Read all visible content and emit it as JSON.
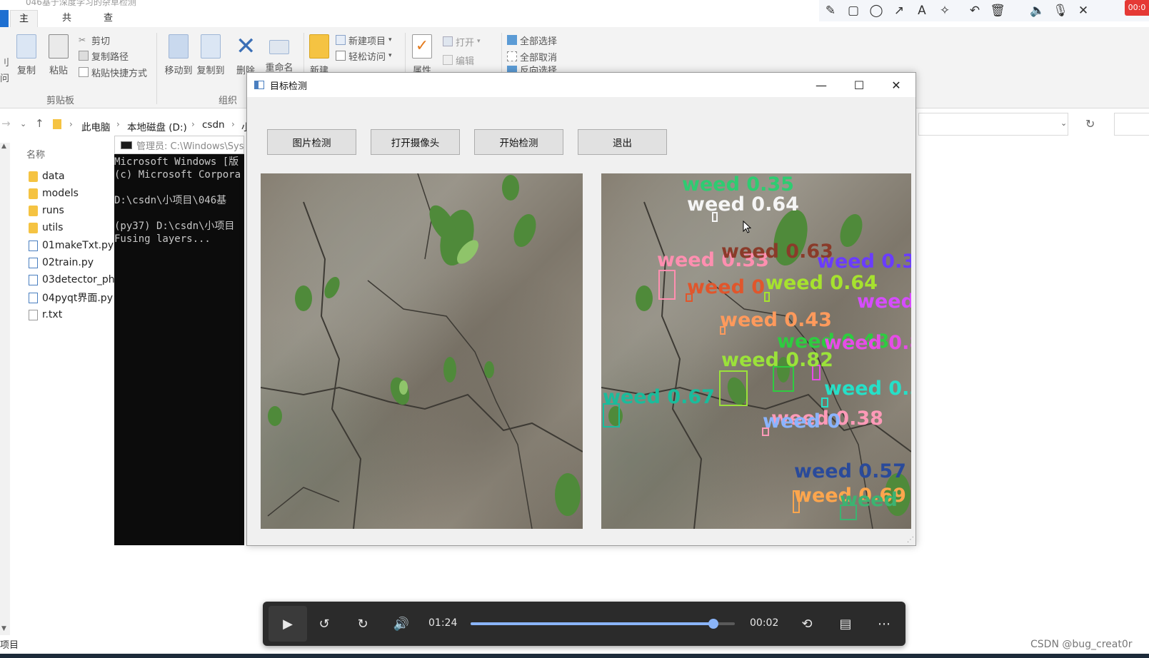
{
  "explorer": {
    "title": "046基于深度学习的杂草检测",
    "tabs": [
      {
        "label": "主页"
      },
      {
        "label": "共享"
      },
      {
        "label": "查看"
      }
    ],
    "ribbon": {
      "copy": "复制",
      "paste": "粘贴",
      "cut": "剪切",
      "copy_path": "复制路径",
      "paste_shortcut": "粘贴快捷方式",
      "move_to": "移动到",
      "copy_to": "复制到",
      "delete": "删除",
      "rename": "重命名",
      "new": "新建",
      "new_item": "新建项目",
      "easy_access": "轻松访问",
      "properties": "属性",
      "open": "打开",
      "edit": "编辑",
      "select_all": "全部选择",
      "select_none": "全部取消",
      "invert_selection": "反向选择",
      "group_clipboard": "剪贴板",
      "group_organize": "组织",
      "partial_left_1": "刂",
      "partial_left_2": "问"
    },
    "breadcrumbs": [
      "此电脑",
      "本地磁盘 (D:)",
      "csdn",
      "小"
    ],
    "column_header": "名称",
    "files": [
      {
        "name": "data",
        "type": "folder"
      },
      {
        "name": "models",
        "type": "folder"
      },
      {
        "name": "runs",
        "type": "folder"
      },
      {
        "name": "utils",
        "type": "folder"
      },
      {
        "name": "01makeTxt.py",
        "type": "py"
      },
      {
        "name": "02train.py",
        "type": "py"
      },
      {
        "name": "03detector_ph",
        "type": "py"
      },
      {
        "name": "04pyqt界面.py",
        "type": "py"
      },
      {
        "name": "r.txt",
        "type": "txt"
      }
    ],
    "status_text": "项目"
  },
  "recorder": {
    "icons": [
      "pencil-icon",
      "rectangle-icon",
      "circle-icon",
      "arrow-icon",
      "text-icon",
      "magic-icon",
      "undo-icon",
      "trash-icon",
      "speaker-icon",
      "mic-icon",
      "close-icon"
    ],
    "time": "00:0"
  },
  "console": {
    "title": "管理员: C:\\Windows\\Sys",
    "lines": [
      "Microsoft Windows [版",
      "(c) Microsoft Corpora",
      "",
      "D:\\csdn\\小项目\\046基",
      "",
      "(py37) D:\\csdn\\小项目",
      "Fusing layers..."
    ]
  },
  "detector": {
    "window_title": "目标检测",
    "buttons": {
      "image_detect": "图片检测",
      "open_camera": "打开摄像头",
      "start_detect": "开始检测",
      "exit": "退出"
    },
    "detections": [
      {
        "label": "weed 0.35",
        "color": "#2ecc71"
      },
      {
        "label": "weed 0.64",
        "color": "#f5f5f5"
      },
      {
        "label": "weed 0.33",
        "color": "#ff8fb0"
      },
      {
        "label": "weed 0.63",
        "color": "#8a3b2a"
      },
      {
        "label": "weed 0.3",
        "color": "#6a3cff"
      },
      {
        "label": "weed 0",
        "color": "#e0562c"
      },
      {
        "label": "weed 0.64",
        "color": "#a6e22e"
      },
      {
        "label": "weed",
        "color": "#d64cff"
      },
      {
        "label": "weed 0.43",
        "color": "#ff9a5c"
      },
      {
        "label": "weed 0.48",
        "color": "#2ecc40"
      },
      {
        "label": "weed 0.8",
        "color": "#e64ce6"
      },
      {
        "label": "weed 0.82",
        "color": "#9be23a"
      },
      {
        "label": "weed 0.5",
        "color": "#26e0c8"
      },
      {
        "label": "weed 0.67",
        "color": "#1abc9c"
      },
      {
        "label": "weed 0.38",
        "color": "#ff9ab8"
      },
      {
        "label": "weed 0",
        "color": "#8ab4ff"
      },
      {
        "label": "weed 0.57",
        "color": "#2a4a9a"
      },
      {
        "label": "weed 0.69",
        "color": "#ffa64d"
      },
      {
        "label": "weed",
        "color": "#3cb371"
      }
    ]
  },
  "player": {
    "current_time": "01:24",
    "remaining_time": "00:02",
    "progress": 0.92,
    "icons": [
      "play-icon",
      "rewind-10-icon",
      "forward-30-icon",
      "volume-icon",
      "repeat-off-icon",
      "captions-icon",
      "more-icon"
    ]
  },
  "watermark": "CSDN @bug_creat0r"
}
